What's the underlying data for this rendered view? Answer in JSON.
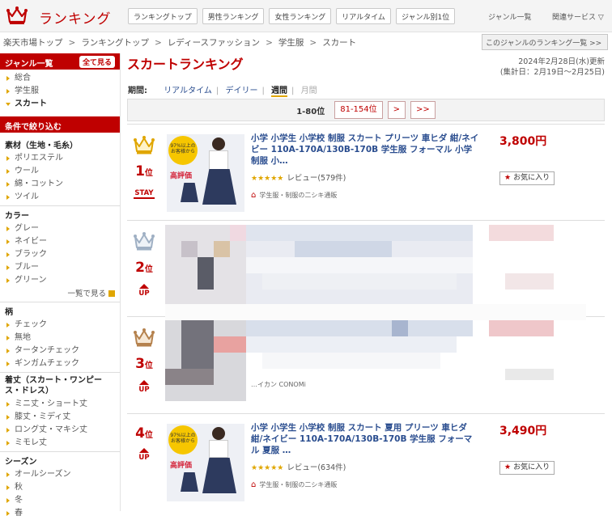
{
  "header": {
    "logo_text": "ランキング",
    "nav": [
      "ランキングトップ",
      "男性ランキング",
      "女性ランキング",
      "リアルタイム",
      "ジャンル別1位"
    ],
    "genre_list": "ジャンル一覧",
    "related": "関連サービス ▽"
  },
  "breadcrumb": [
    "楽天市場トップ",
    "ランキングトップ",
    "レディースファッション",
    "学生服",
    "スカート"
  ],
  "breadcrumb_sep": ">",
  "other_genre": "このジャンルのランキング一覧 >>",
  "sidebar": {
    "genre_title": "ジャンル一覧",
    "see_all": "全て見る",
    "genres": [
      "総合",
      "学生服",
      "スカート"
    ],
    "filter_title": "条件で絞り込む",
    "sections": [
      {
        "title": "素材（生地・毛糸）",
        "items": [
          "ポリエステル",
          "ウール",
          "綿・コットン",
          "ツイル"
        ]
      },
      {
        "title": "カラー",
        "items": [
          "グレー",
          "ネイビー",
          "ブラック",
          "ブルー",
          "グリーン"
        ],
        "more": "一覧で見る"
      },
      {
        "title": "柄",
        "items": [
          "チェック",
          "無地",
          "タータンチェック",
          "ギンガムチェック"
        ]
      },
      {
        "title": "着丈（スカート・ワンピース・ドレス）",
        "items": [
          "ミニ丈・ショート丈",
          "膝丈・ミディ丈",
          "ロング丈・マキシ丈",
          "ミモレ丈"
        ]
      },
      {
        "title": "シーズン",
        "items": [
          "オールシーズン",
          "秋",
          "冬",
          "春"
        ]
      }
    ]
  },
  "main": {
    "title": "スカートランキング",
    "updated": "2024年2月28日(水)更新",
    "period_range": "(集計日：2月19日〜2月25日)",
    "period_label": "期間:",
    "periods": [
      "リアルタイム",
      "デイリー",
      "週間",
      "月間"
    ],
    "pager": {
      "current": "1-80位",
      "next": "81-154位",
      "arrow1": ">",
      "arrow2": ">>"
    }
  },
  "items": [
    {
      "rank": "1",
      "rank_suffix": "位",
      "status": "STAY",
      "name": "小学 小学生 小学校 制服 スカート プリーツ 車ヒダ 紺/ネイビー 110A-170A/130B-170B 学生服 フォーマル 小学制服 小…",
      "stars": "★★★★★",
      "review": "レビュー(579件)",
      "shop": "学生服・制服の二シキ通販",
      "price": "3,800円",
      "fav": "お気に入り",
      "thumb_badge": "97%以上のお客様から",
      "thumb_badge2": "高評価"
    },
    {
      "rank": "2",
      "rank_suffix": "位",
      "status": "UP"
    },
    {
      "rank": "3",
      "rank_suffix": "位",
      "status": "UP",
      "shop_partial": "…イカン CONOMi"
    },
    {
      "rank": "4",
      "rank_suffix": "位",
      "status": "UP",
      "name": "小学 小学生 小学校 制服 スカート 夏用 プリーツ 車ヒダ 紺/ネイビー 110A-170A/130B-170B 学生服 フォーマル 夏服 …",
      "stars": "★★★★★",
      "review": "レビュー(634件)",
      "shop": "学生服・制服の二シキ通販",
      "price": "3,490円",
      "fav": "お気に入り",
      "thumb_badge": "97%以上のお客様から",
      "thumb_badge2": "高評価"
    }
  ],
  "colors": {
    "brand": "#bf0000",
    "gold": "#e0a600",
    "link": "#2a4d8f"
  }
}
